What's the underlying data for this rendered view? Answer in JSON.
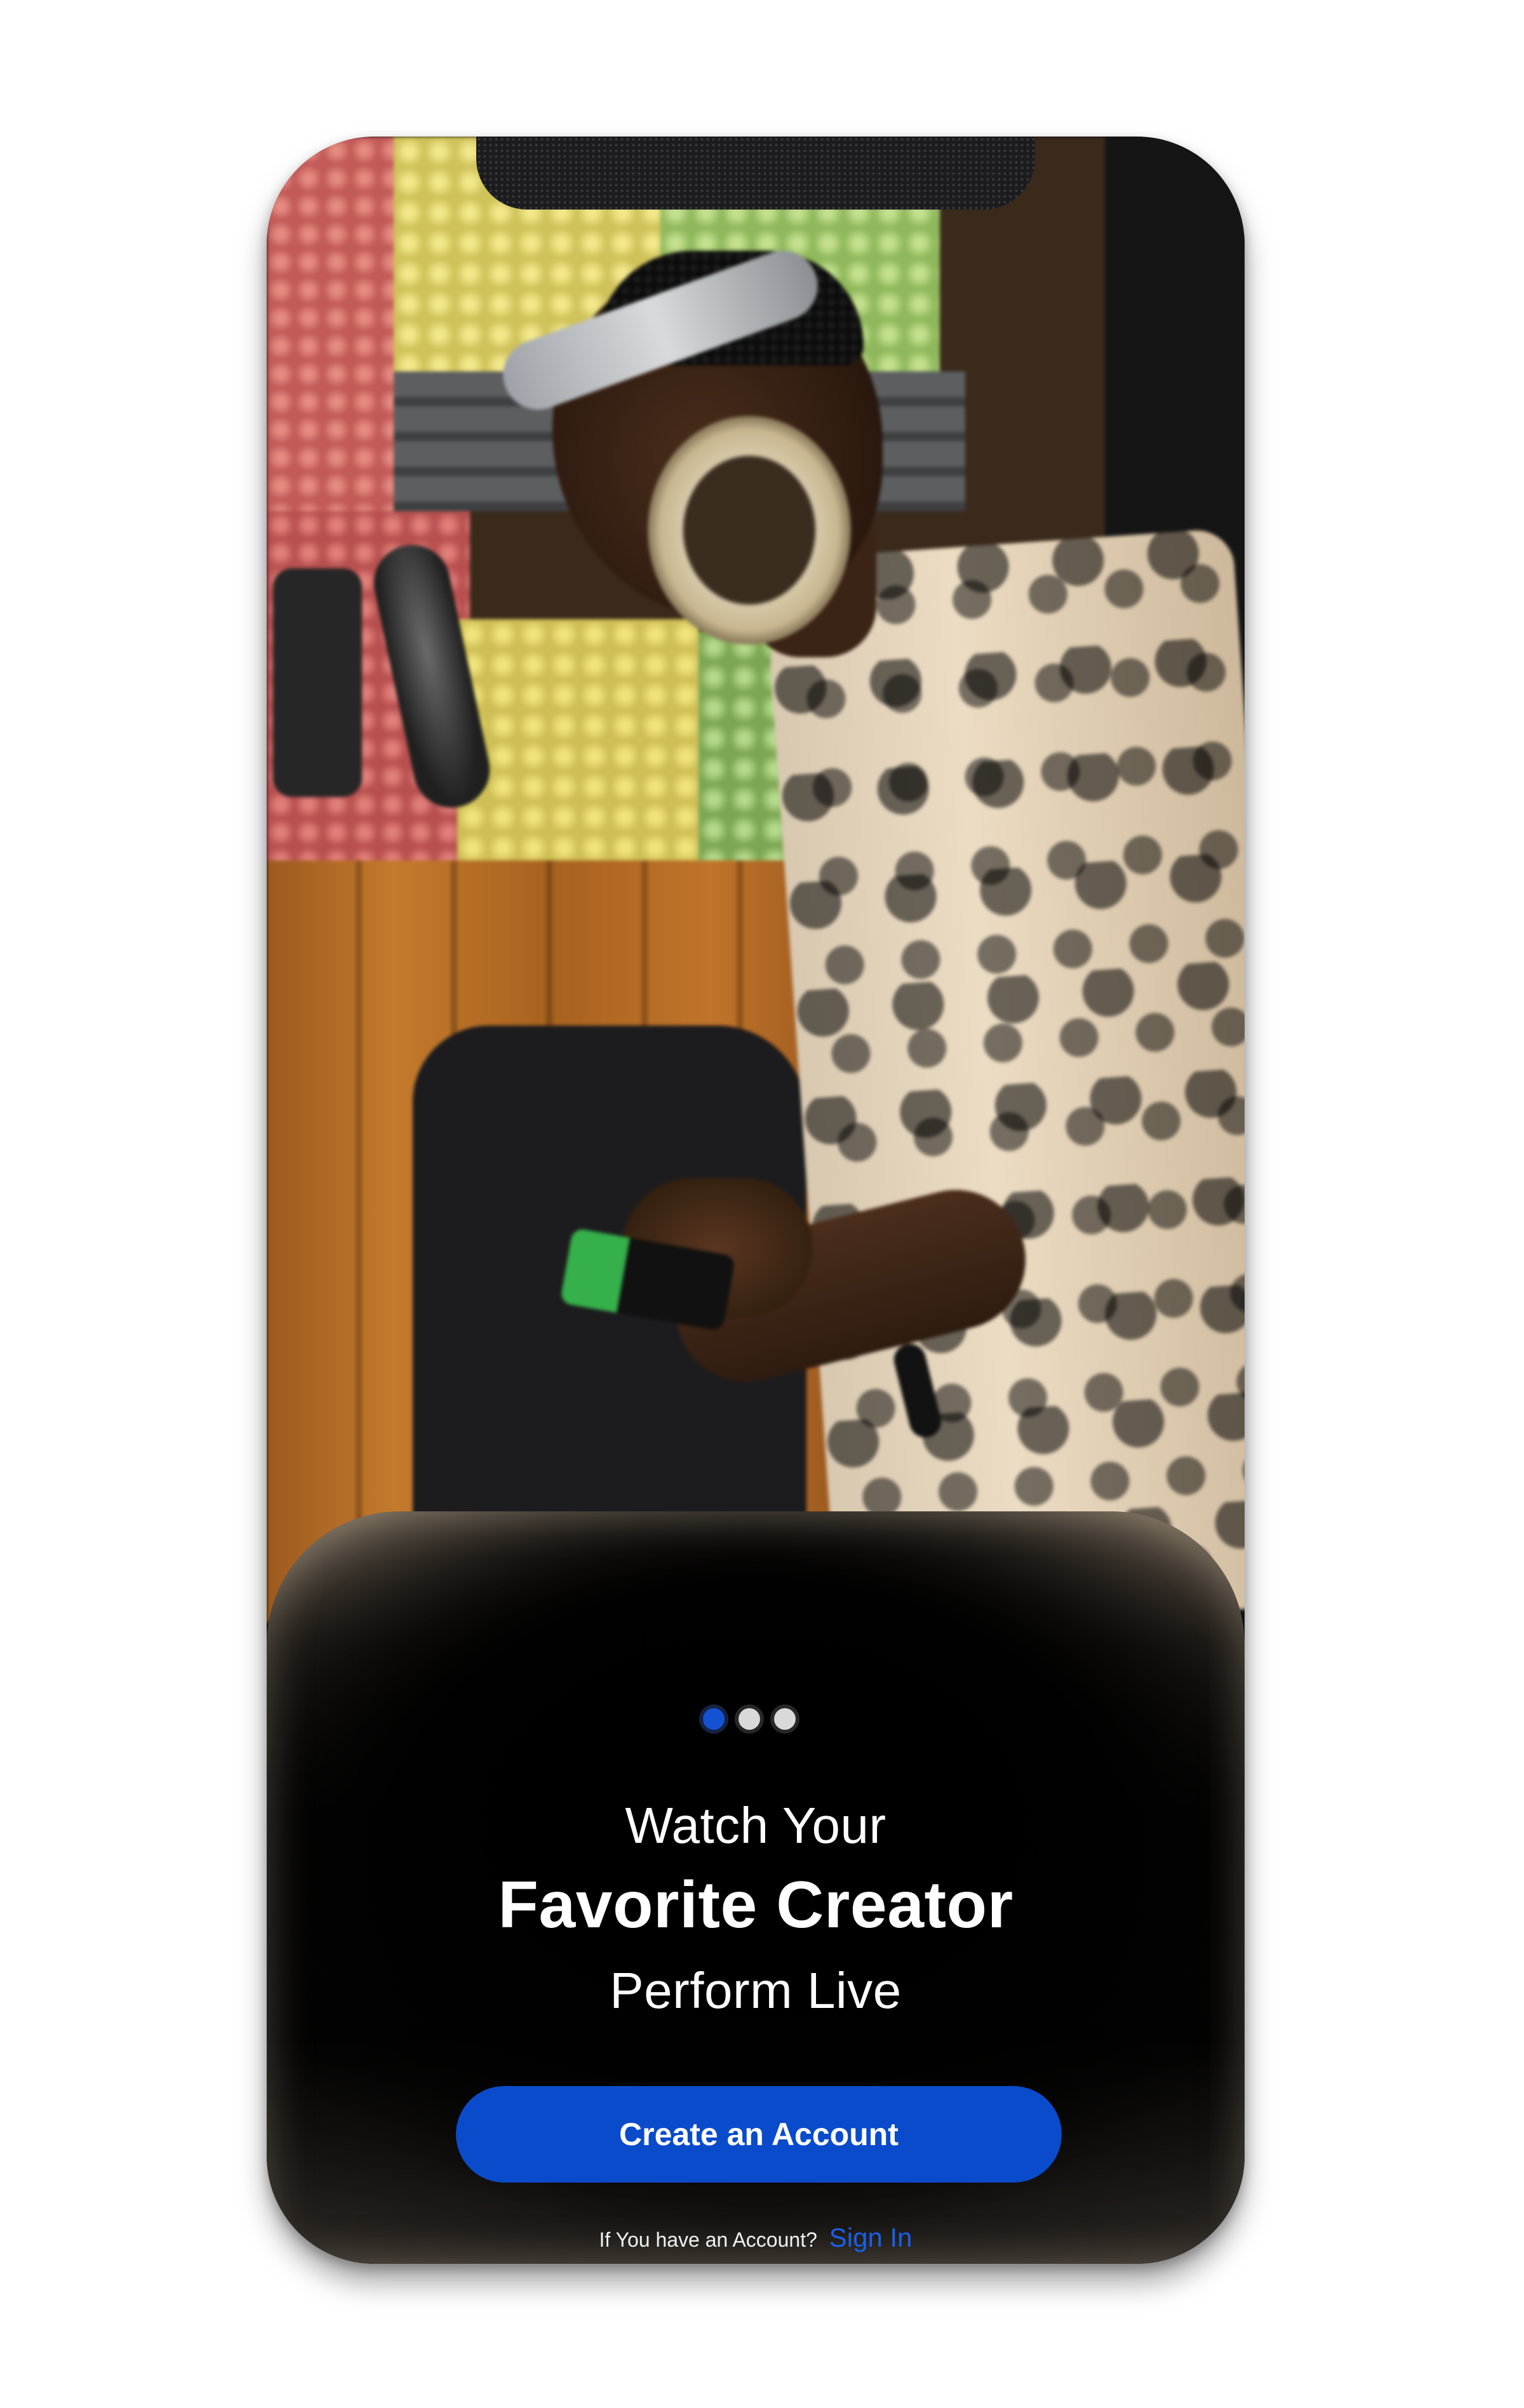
{
  "onboarding": {
    "headline_line1": "Watch Your",
    "headline_line2": "Favorite Creator",
    "headline_line3": "Perform Live",
    "create_account_label": "Create an Account",
    "signin_prompt": "If You have an Account?",
    "signin_link": "Sign In",
    "pager": {
      "total": 3,
      "active_index": 0
    }
  },
  "colors": {
    "accent": "#0a4bcb",
    "link": "#1b5fe6",
    "active_dot": "#1452d4",
    "inactive_dot": "#d9d9d9",
    "sheet": "#050505"
  }
}
